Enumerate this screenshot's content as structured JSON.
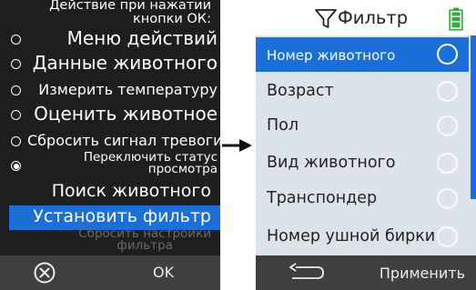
{
  "left_screen": {
    "header_lines": [
      "Действие при нажатии",
      "кнопки ОК:"
    ],
    "options": [
      {
        "label": "Меню действий",
        "selected": false
      },
      {
        "label": "Данные животного",
        "selected": false
      },
      {
        "label": "Измерить температуру",
        "selected": false
      },
      {
        "label": "Оценить животное",
        "selected": false
      },
      {
        "label": "Сбросить сигнал тревоги",
        "selected": false
      },
      {
        "label_lines": [
          "Переключить статус",
          "просмотра"
        ],
        "selected": true
      }
    ],
    "search_animal": "Поиск животного",
    "set_filter": "Установить фильтр",
    "reset_settings_lines": [
      "Сбросить настройки",
      "фильтра"
    ],
    "bottom_bar": {
      "cancel_icon": "cancel-circle-x-icon",
      "ok_label": "OK"
    }
  },
  "arrow_icon": "right-arrow-icon",
  "right_screen": {
    "title": "Фильтр",
    "title_icon": "funnel-icon",
    "battery_icon": "battery-full-icon",
    "items": [
      {
        "label": "Номер животного",
        "selected": true
      },
      {
        "label": "Возраст",
        "selected": false
      },
      {
        "label": "Пол",
        "selected": false
      },
      {
        "label": "Вид животного",
        "selected": false
      },
      {
        "label": "Транспондер",
        "selected": false
      },
      {
        "label": "Номер ушной бирки",
        "selected": false
      }
    ],
    "bottom_bar": {
      "back_icon": "back-arrow-icon",
      "apply_label": "Применить"
    }
  },
  "colors": {
    "accent_blue": "#1b6fd9",
    "battery_green": "#2fae3a",
    "dark_bg": "#1e1e1e",
    "bar_bg": "#3f3f3f",
    "list_bg": "#dde3ea"
  }
}
